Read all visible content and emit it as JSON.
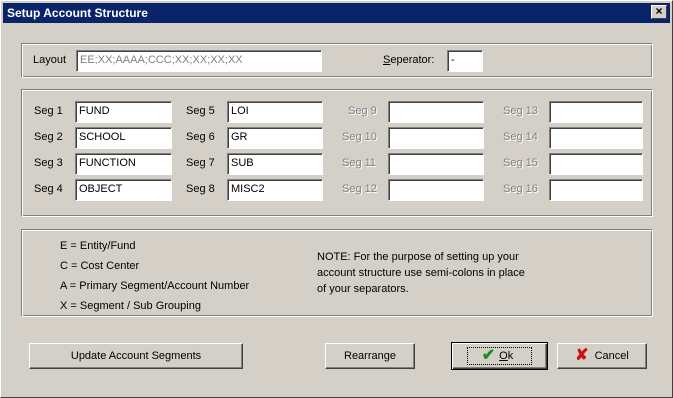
{
  "window": {
    "title": "Setup Account Structure"
  },
  "layout": {
    "label": "Layout",
    "value": "EE;XX;AAAA;CCC;XX;XX;XX;XX",
    "separator_label_prefix": "",
    "separator_label_mnemonic": "S",
    "separator_label_rest": "eperator:",
    "separator_value": "-"
  },
  "segments": [
    {
      "label": "Seg 1",
      "value": "FUND"
    },
    {
      "label": "Seg 2",
      "value": "SCHOOL"
    },
    {
      "label": "Seg 3",
      "value": "FUNCTION"
    },
    {
      "label": "Seg 4",
      "value": "OBJECT"
    },
    {
      "label": "Seg 5",
      "value": "LOI"
    },
    {
      "label": "Seg 6",
      "value": "GR"
    },
    {
      "label": "Seg 7",
      "value": "SUB"
    },
    {
      "label": "Seg 8",
      "value": "MISC2"
    },
    {
      "label": "Seg 9",
      "value": ""
    },
    {
      "label": "Seg 10",
      "value": ""
    },
    {
      "label": "Seg 11",
      "value": ""
    },
    {
      "label": "Seg 12",
      "value": ""
    },
    {
      "label": "Seg 13",
      "value": ""
    },
    {
      "label": "Seg 14",
      "value": ""
    },
    {
      "label": "Seg 15",
      "value": ""
    },
    {
      "label": "Seg 16",
      "value": ""
    }
  ],
  "legend": [
    "E = Entity/Fund",
    "C = Cost Center",
    "A = Primary Segment/Account Number",
    "X = Segment / Sub Grouping"
  ],
  "note": [
    "NOTE: For the purpose of setting up your",
    "account structure use semi-colons in place",
    "of your separators."
  ],
  "buttons": {
    "update": "Update Account Segments",
    "rearrange": "Rearrange",
    "ok_mnemonic": "O",
    "ok_rest": "k",
    "cancel": "Cancel"
  },
  "icons": {
    "close": "close-icon",
    "ok": "checkmark-icon",
    "cancel": "x-icon"
  },
  "colors": {
    "titlebar": "#0a246a",
    "dialog_face": "#d4d0c8",
    "check": "#1a8f1a",
    "cancel_x": "#cc1111"
  }
}
